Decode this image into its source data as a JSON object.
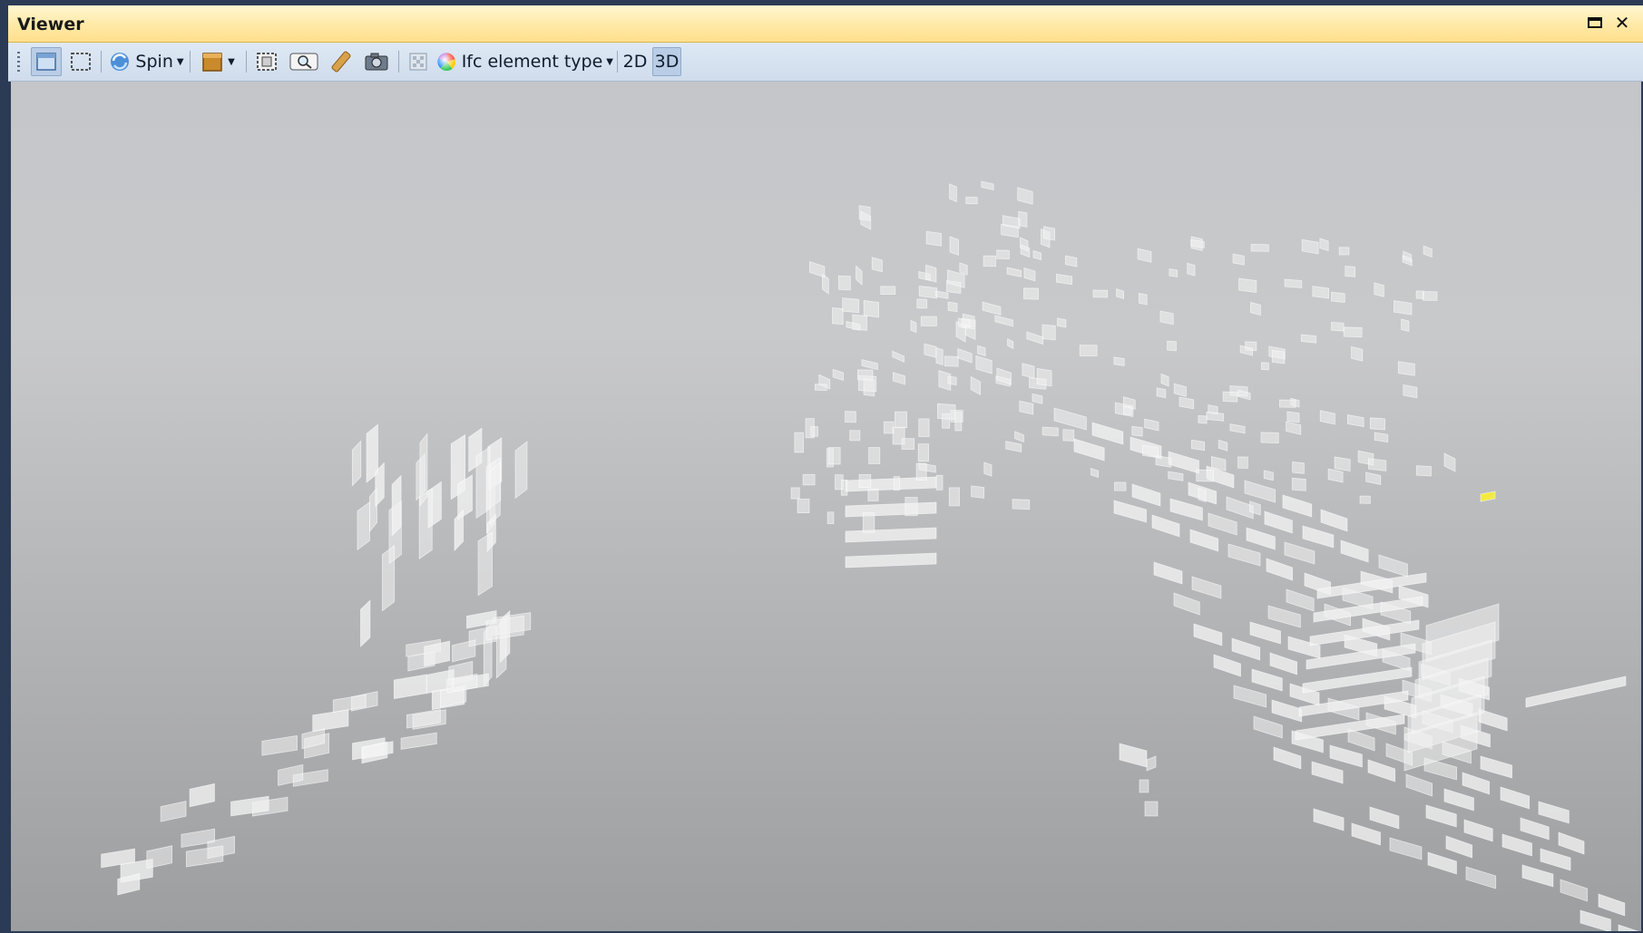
{
  "window": {
    "title": "Viewer",
    "restore_icon": "restore-window-icon",
    "close_icon": "close-icon",
    "close_glyph": "✕"
  },
  "toolbar": {
    "spin_label": "Spin",
    "color_mode_label": "Ifc element type",
    "view_2d_label": "2D",
    "view_3d_label": "3D",
    "active_view": "3D",
    "icons": [
      "select-icon",
      "marquee-select-icon",
      "spin-icon",
      "section-box-icon",
      "zoom-extents-icon",
      "zoom-selection-icon",
      "measure-icon",
      "camera-icon",
      "transparency-icon",
      "color-wheel-icon"
    ]
  },
  "viewport": {
    "content": "3D building model with translucent window and glazing panels",
    "background_top": "#c4c6c9",
    "background_bottom": "#9d9ea0",
    "highlight_color": "#f4ec3a"
  }
}
